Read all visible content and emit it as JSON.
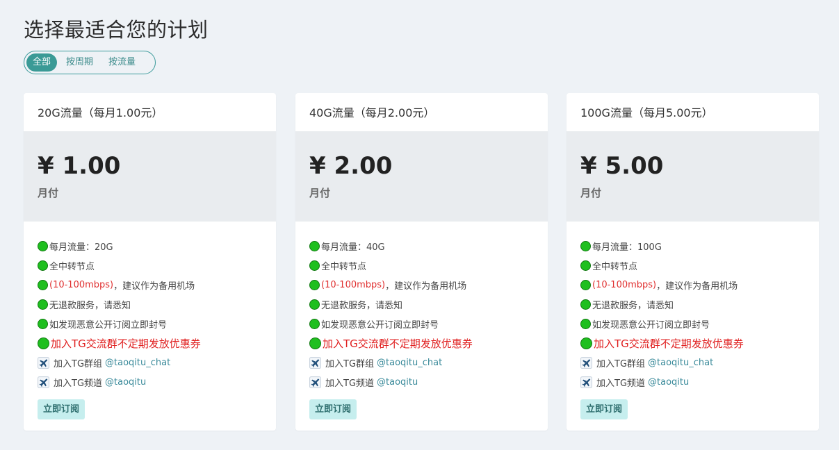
{
  "page": {
    "title": "选择最适合您的计划"
  },
  "filter": {
    "options": [
      "全部",
      "按周期",
      "按流量"
    ],
    "active": "全部"
  },
  "colors": {
    "accent": "#3a9a96",
    "bullet": "#1fbf1f",
    "promo": "#e02020",
    "price_bg": "#e9ecef"
  },
  "plans": [
    {
      "name": "20G流量（每月1.00元）",
      "price": "¥ 1.00",
      "period": "月付",
      "features": {
        "traffic": "每月流量：20G",
        "nodes": "全中转节点",
        "speed_value": "(10-100mbps)",
        "speed_note": "，建议作为备用机场",
        "refund": "无退款服务，请悉知",
        "abuse": "如发现恶意公开订阅立即封号",
        "promo": "加入TG交流群不定期发放优惠券",
        "tg_group_label": "加入TG群组",
        "tg_group_handle": "@taoqitu_chat",
        "tg_channel_label": "加入TG频道",
        "tg_channel_handle": "@taoqitu"
      },
      "subscribe_label": "立即订阅"
    },
    {
      "name": "40G流量（每月2.00元）",
      "price": "¥ 2.00",
      "period": "月付",
      "features": {
        "traffic": "每月流量：40G",
        "nodes": "全中转节点",
        "speed_value": "(10-100mbps)",
        "speed_note": "，建议作为备用机场",
        "refund": "无退款服务，请悉知",
        "abuse": "如发现恶意公开订阅立即封号",
        "promo": "加入TG交流群不定期发放优惠券",
        "tg_group_label": "加入TG群组",
        "tg_group_handle": "@taoqitu_chat",
        "tg_channel_label": "加入TG频道",
        "tg_channel_handle": "@taoqitu"
      },
      "subscribe_label": "立即订阅"
    },
    {
      "name": "100G流量（每月5.00元）",
      "price": "¥ 5.00",
      "period": "月付",
      "features": {
        "traffic": "每月流量：100G",
        "nodes": "全中转节点",
        "speed_value": "(10-100mbps)",
        "speed_note": "，建议作为备用机场",
        "refund": "无退款服务，请悉知",
        "abuse": "如发现恶意公开订阅立即封号",
        "promo": "加入TG交流群不定期发放优惠券",
        "tg_group_label": "加入TG群组",
        "tg_group_handle": "@taoqitu_chat",
        "tg_channel_label": "加入TG频道",
        "tg_channel_handle": "@taoqitu"
      },
      "subscribe_label": "立即订阅"
    }
  ]
}
